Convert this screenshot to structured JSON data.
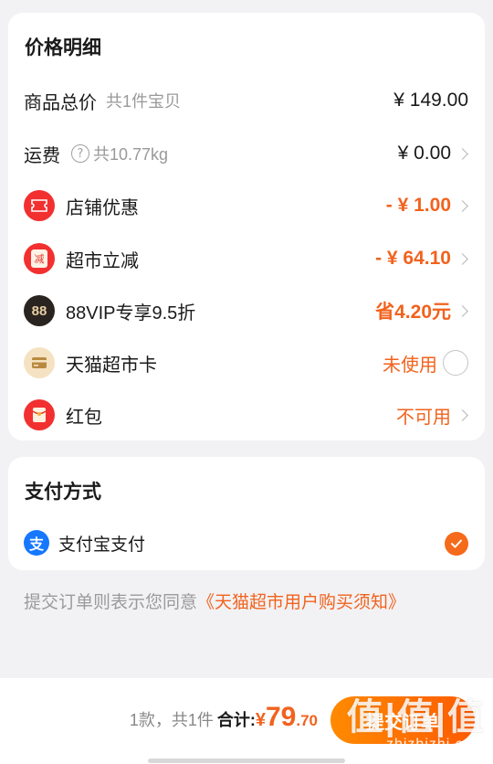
{
  "price_detail": {
    "title": "价格明细",
    "goods_total": {
      "label": "商品总价",
      "sub": "共1件宝贝",
      "amount": "¥ 149.00"
    },
    "shipping": {
      "label": "运费",
      "help_glyph": "?",
      "sub": "共10.77kg",
      "amount": "¥ 0.00"
    },
    "shop_discount": {
      "label": "店铺优惠",
      "amount": "- ¥ 1.00",
      "icon": "ticket-icon"
    },
    "supermarket_discount": {
      "label": "超市立减",
      "amount": "- ¥ 64.10",
      "icon_char": "减"
    },
    "vip": {
      "label": "88VIP专享9.5折",
      "amount": "省4.20元",
      "icon_text": "88"
    },
    "tmall_card": {
      "label": "天猫超市卡",
      "status": "未使用",
      "icon": "card-icon"
    },
    "red_packet": {
      "label": "红包",
      "status": "不可用",
      "icon": "red-envelope-icon"
    }
  },
  "payment": {
    "title": "支付方式",
    "method": {
      "label": "支付宝支付",
      "icon_char": "支",
      "selected": true
    }
  },
  "agreement": {
    "text": "提交订单则表示您同意",
    "link": "《天猫超市用户购买须知》"
  },
  "bottom_bar": {
    "count": "1款，共1件",
    "total_label": "合计:",
    "currency": "¥",
    "total_int": "79",
    "total_dec": ".70",
    "submit_label": "提交订单"
  },
  "watermark": {
    "big": "值|值|值",
    "small": "zhizhizhi.com"
  },
  "colors": {
    "accent": "#f2621d",
    "discount_red": "#f23030",
    "alipay_blue": "#1677ff",
    "background": "#f2f2f4"
  }
}
